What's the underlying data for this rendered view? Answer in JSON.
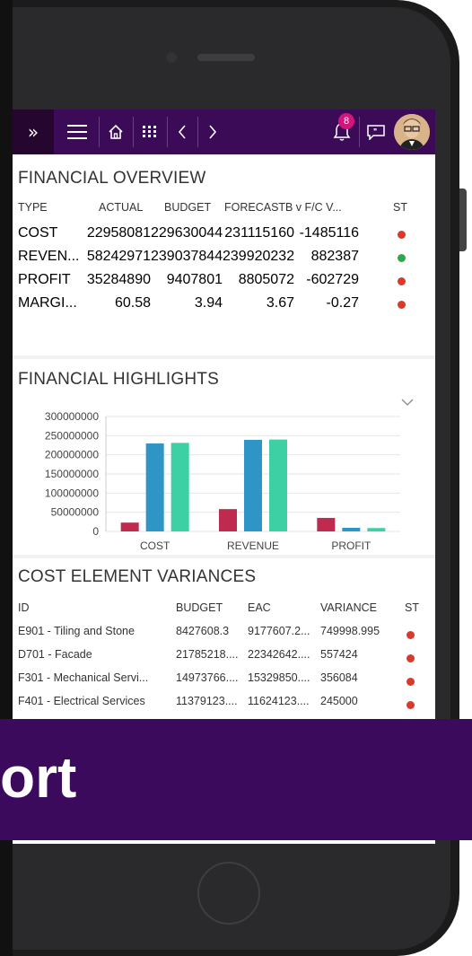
{
  "colors": {
    "topbar": "#3b0b57",
    "banner": "#3c0a5c",
    "red_status": "#d93a2b",
    "green_status": "#2ea84a",
    "budget_bar": "#bf2a4f",
    "actual_bar": "#2f95c6",
    "forecast_bar": "#3dd0a5"
  },
  "topbar": {
    "icons": [
      "double-chevron-right-icon",
      "hamburger-menu-icon",
      "home-icon",
      "apps-grid-icon",
      "chevron-left-icon",
      "chevron-right-icon",
      "bell-icon",
      "chat-icon"
    ],
    "notification_count": "8"
  },
  "overview": {
    "title": "FINANCIAL OVERVIEW",
    "columns": [
      "TYPE",
      "ACTUAL",
      "BUDGET",
      "FORECAST",
      "B v F/C V...",
      "ST"
    ],
    "rows": [
      {
        "type": "COST",
        "actual": "22958081",
        "budget": "229630044",
        "forecast": "231115160",
        "variance": "-1485116",
        "status": "red"
      },
      {
        "type": "REVEN...",
        "actual": "58242971",
        "budget": "239037844",
        "forecast": "239920232",
        "variance": "882387",
        "status": "green"
      },
      {
        "type": "PROFIT",
        "actual": "35284890",
        "budget": "9407801",
        "forecast": "8805072",
        "variance": "-602729",
        "status": "red"
      },
      {
        "type": "MARGI...",
        "actual": "60.58",
        "budget": "3.94",
        "forecast": "3.67",
        "variance": "-0.27",
        "status": "red"
      }
    ]
  },
  "highlights": {
    "title": "FINANCIAL HIGHLIGHTS"
  },
  "chart_data": {
    "type": "bar",
    "categories": [
      "COST",
      "REVENUE",
      "PROFIT"
    ],
    "series": [
      {
        "values": [
          22958081,
          58242971,
          35284890
        ],
        "color": "#bf2a4f"
      },
      {
        "values": [
          229630044,
          239037844,
          9407801
        ],
        "color": "#2f95c6"
      },
      {
        "values": [
          231115160,
          239920232,
          8805072
        ],
        "color": "#3dd0a5"
      }
    ],
    "yticks": [
      "300000000",
      "250000000",
      "200000000",
      "150000000",
      "100000000",
      "50000000",
      "0"
    ],
    "ylim": [
      0,
      300000000
    ],
    "grid": true
  },
  "variances": {
    "title": "COST ELEMENT VARIANCES",
    "columns": [
      "ID",
      "BUDGET",
      "EAC",
      "VARIANCE",
      "ST"
    ],
    "rows": [
      {
        "id": "E901 - Tiling and Stone",
        "budget": "8427608.3",
        "eac": "9177607.2...",
        "variance": "749998.995",
        "status": "red"
      },
      {
        "id": "D701 - Facade",
        "budget": "21785218....",
        "eac": "22342642....",
        "variance": "557424",
        "status": "red"
      },
      {
        "id": "F301 - Mechanical Servi...",
        "budget": "14973766....",
        "eac": "15329850....",
        "variance": "356084",
        "status": "red"
      },
      {
        "id": "F401 - Electrical Services",
        "budget": "11379123....",
        "eac": "11624123....",
        "variance": "245000",
        "status": "red"
      }
    ]
  },
  "banner": {
    "text": "ort"
  }
}
